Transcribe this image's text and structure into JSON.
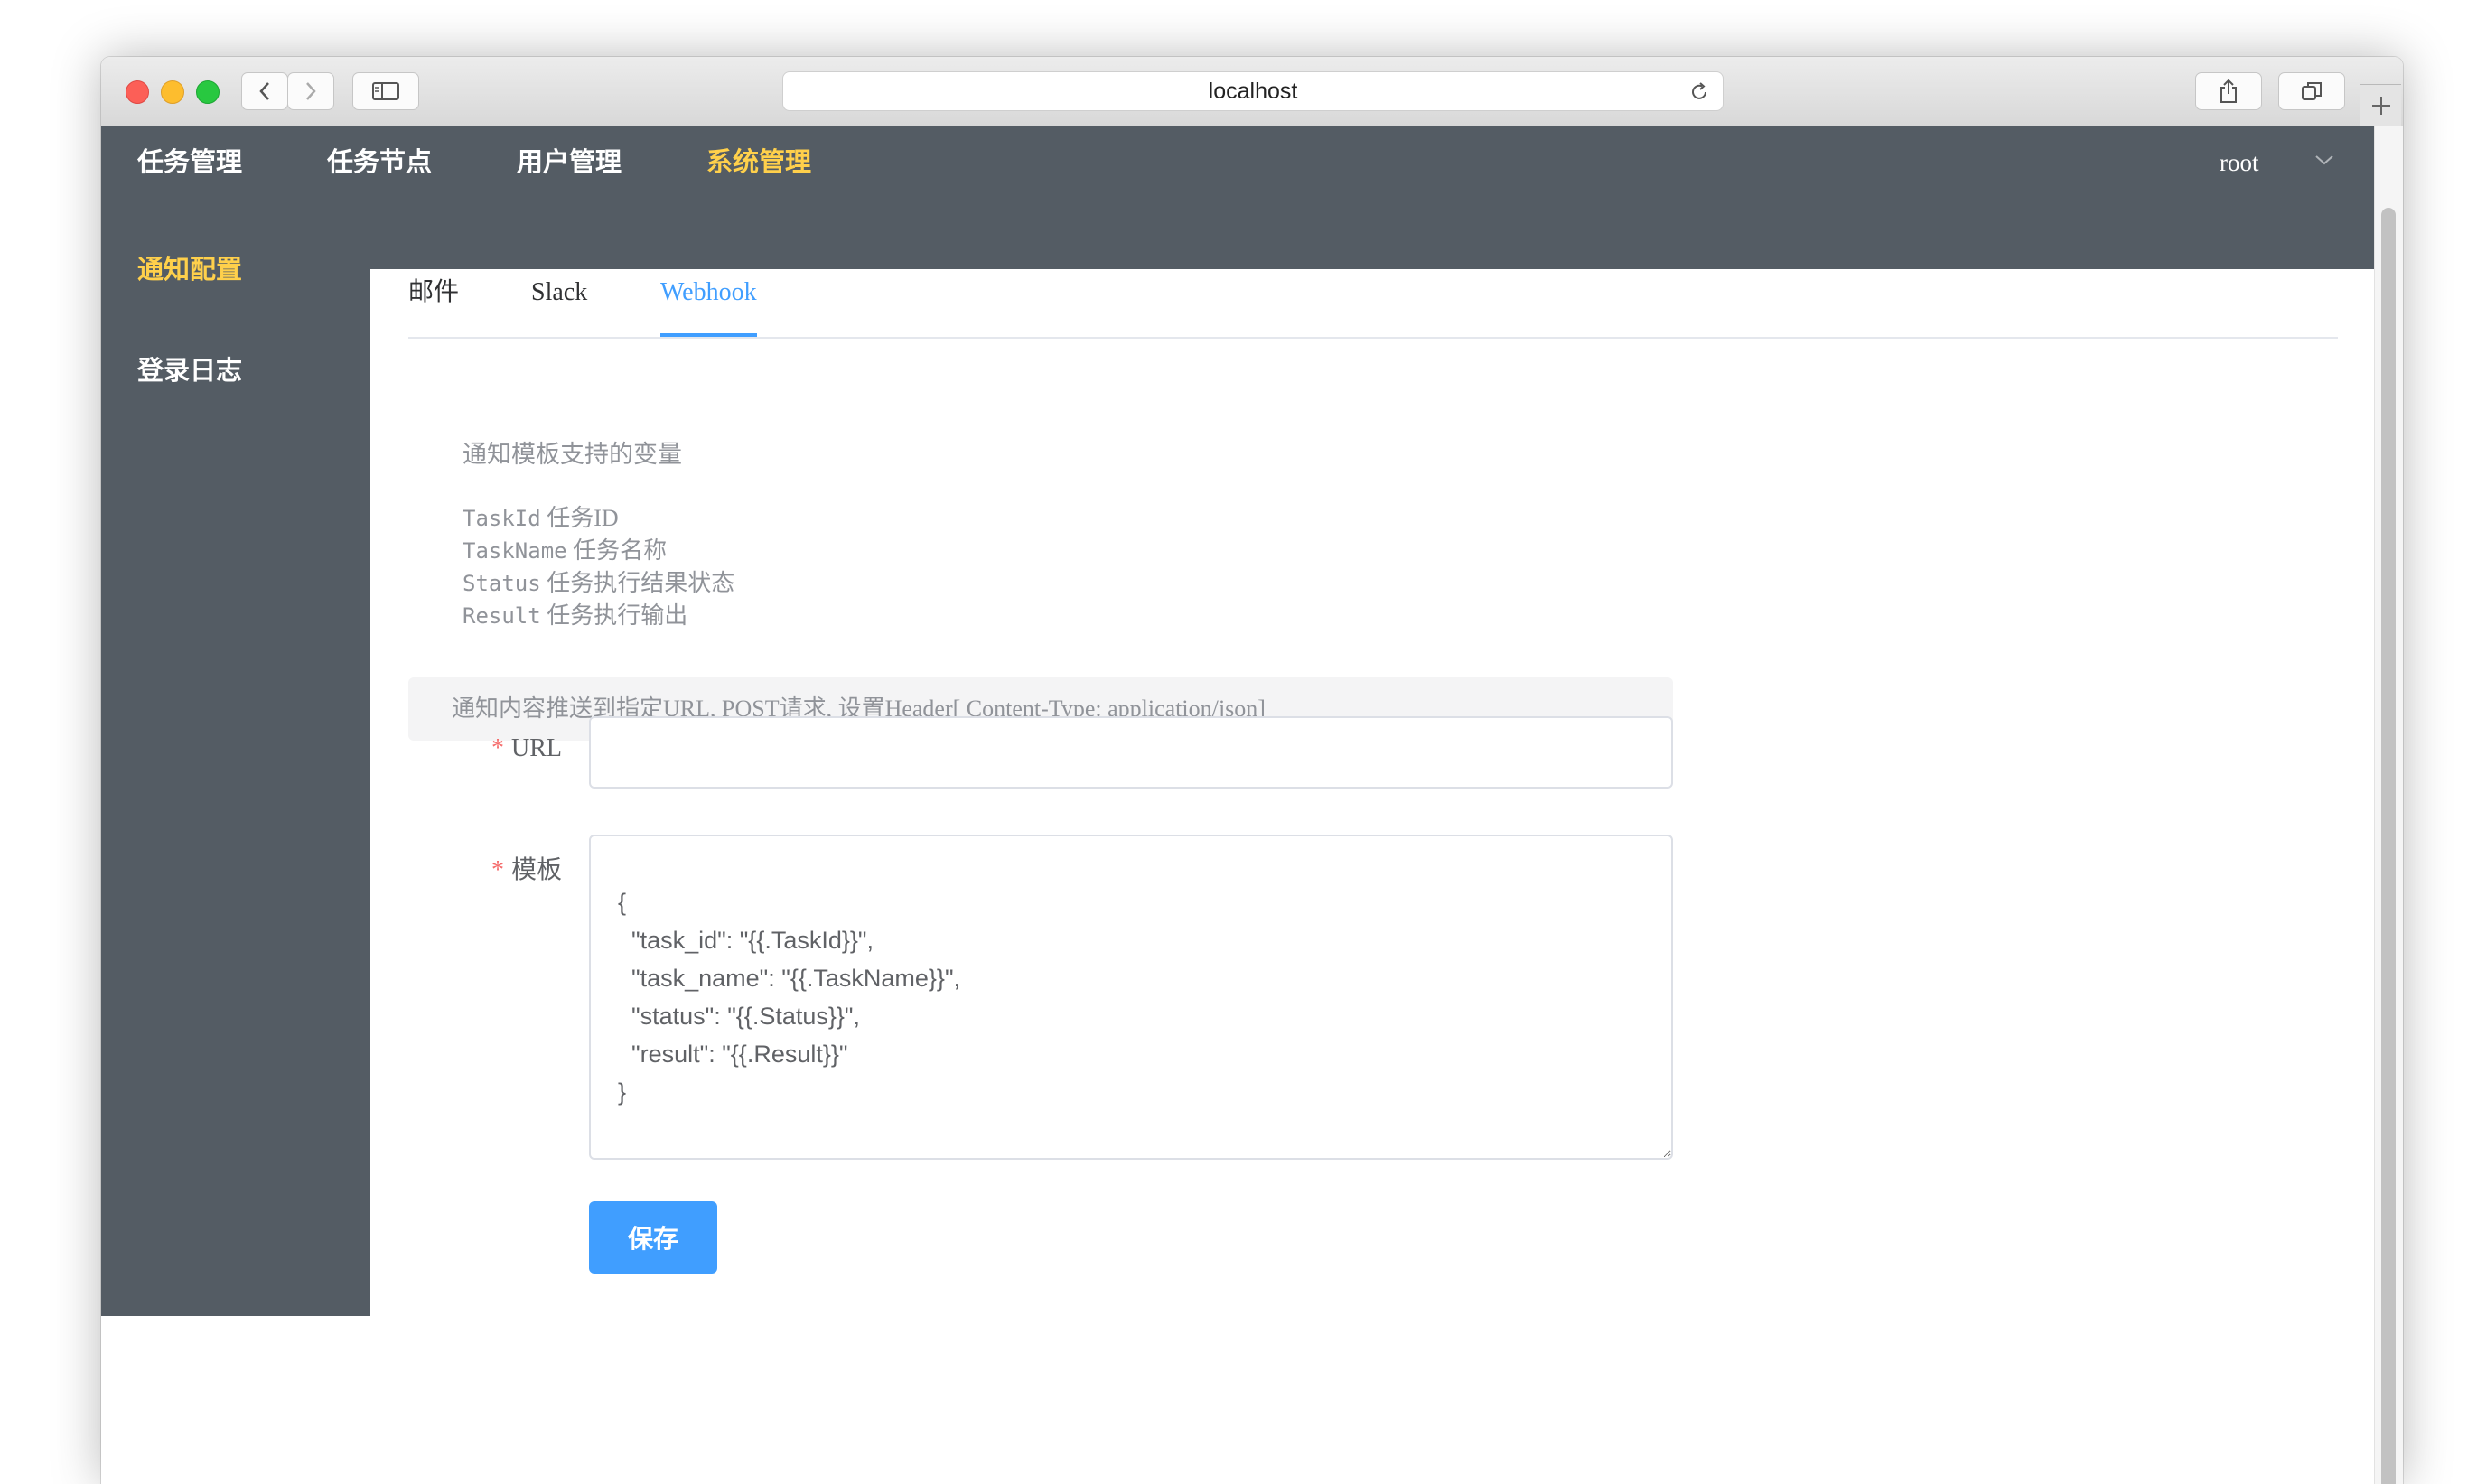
{
  "browser": {
    "url": "localhost",
    "icons": [
      "back-icon",
      "forward-icon",
      "sidebar-icon",
      "reload-icon",
      "share-icon",
      "tabs-icon",
      "plus-icon"
    ]
  },
  "topnav": {
    "items": [
      {
        "label": "任务管理",
        "active": false
      },
      {
        "label": "任务节点",
        "active": false
      },
      {
        "label": "用户管理",
        "active": false
      },
      {
        "label": "系统管理",
        "active": true
      }
    ],
    "user": "root",
    "background": "#545c64",
    "active_color": "#ffd04b"
  },
  "sidebar": {
    "items": [
      {
        "label": "通知配置",
        "active": true
      },
      {
        "label": "登录日志",
        "active": false
      }
    ]
  },
  "tabs": [
    {
      "label": "邮件",
      "active": false
    },
    {
      "label": "Slack",
      "active": false
    },
    {
      "label": "Webhook",
      "active": true
    }
  ],
  "variables": {
    "title": "通知模板支持的变量",
    "items": [
      {
        "name": "TaskId",
        "desc": "任务ID"
      },
      {
        "name": "TaskName",
        "desc": "任务名称"
      },
      {
        "name": "Status",
        "desc": "任务执行结果状态"
      },
      {
        "name": "Result",
        "desc": "任务执行输出"
      }
    ]
  },
  "alert": "通知内容推送到指定URL, POST请求, 设置Header[ Content-Type: application/json]",
  "form": {
    "url_label": "URL",
    "url_value": "",
    "template_label": "模板",
    "template_value": "{\n  \"task_id\": \"{{.TaskId}}\",\n  \"task_name\": \"{{.TaskName}}\",\n  \"status\": \"{{.Status}}\",\n  \"result\": \"{{.Result}}\"\n}",
    "required_mark": "*",
    "save_label": "保存"
  },
  "colors": {
    "primary": "#409eff",
    "required": "#f56c6c"
  }
}
